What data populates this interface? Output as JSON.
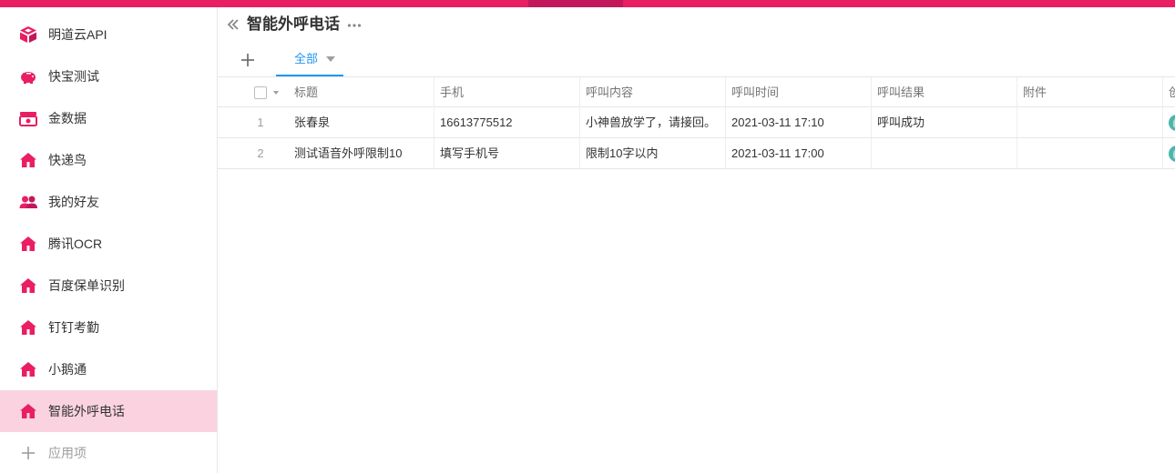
{
  "colors": {
    "brand": "#e91e63",
    "brand_dark": "#c2185b",
    "active_bg": "#fbd3e0",
    "tab_accent": "#2196f3",
    "avatar": "#4db6ac"
  },
  "sidebar": {
    "items": [
      {
        "label": "明道云API",
        "icon": "api-box-icon"
      },
      {
        "label": "快宝测试",
        "icon": "piggy-bank-icon"
      },
      {
        "label": "金数据",
        "icon": "money-icon"
      },
      {
        "label": "快递鸟",
        "icon": "home-icon"
      },
      {
        "label": "我的好友",
        "icon": "friends-icon"
      },
      {
        "label": "腾讯OCR",
        "icon": "home-icon"
      },
      {
        "label": "百度保单识别",
        "icon": "home-icon"
      },
      {
        "label": "钉钉考勤",
        "icon": "home-icon"
      },
      {
        "label": "小鹅通",
        "icon": "home-icon"
      },
      {
        "label": "智能外呼电话",
        "icon": "home-icon",
        "active": true
      }
    ],
    "add_label": "应用项"
  },
  "header": {
    "title": "智能外呼电话"
  },
  "tabs": {
    "active_label": "全部"
  },
  "table": {
    "columns": [
      "标题",
      "手机",
      "呼叫内容",
      "呼叫时间",
      "呼叫结果",
      "附件",
      "创"
    ],
    "rows": [
      {
        "num": "1",
        "cells": [
          "张春泉",
          "16613775512",
          "小神兽放学了，请接回。",
          "2021-03-11 17:10",
          "呼叫成功",
          ""
        ]
      },
      {
        "num": "2",
        "cells": [
          "测试语音外呼限制10",
          "填写手机号",
          "限制10字以内",
          "2021-03-11 17:00",
          "",
          ""
        ]
      }
    ]
  }
}
